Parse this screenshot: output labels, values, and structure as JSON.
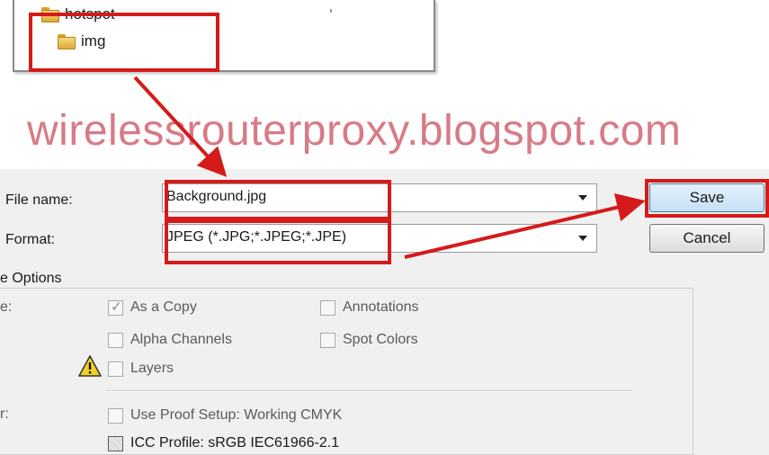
{
  "tree": {
    "items": [
      {
        "label": "hotspot",
        "icon": "folder-icon"
      },
      {
        "label": "img",
        "icon": "folder-icon"
      }
    ]
  },
  "watermark": "wirelessrouterproxy.blogspot.com",
  "form": {
    "file_name_label": "File name:",
    "file_name_value": "Background.jpg",
    "format_label": "Format:",
    "format_value": "JPEG (*.JPG;*.JPEG;*.JPE)"
  },
  "buttons": {
    "save": "Save",
    "cancel": "Cancel"
  },
  "options": {
    "legend": "e Options",
    "save_label": "e:",
    "checkboxes": [
      {
        "label": "As a Copy",
        "checked": true
      },
      {
        "label": "Annotations",
        "checked": false
      },
      {
        "label": "Alpha Channels",
        "checked": false
      },
      {
        "label": "Spot Colors",
        "checked": false
      },
      {
        "label": "Layers",
        "checked": false
      }
    ],
    "color_label": "r:",
    "use_proof_setup": "Use Proof Setup:  Working CMYK",
    "icc_profile": "ICC Profile:  sRGB IEC61966-2.1"
  },
  "colors": {
    "highlight": "#d51a1a",
    "watermark": "#d77b86"
  }
}
